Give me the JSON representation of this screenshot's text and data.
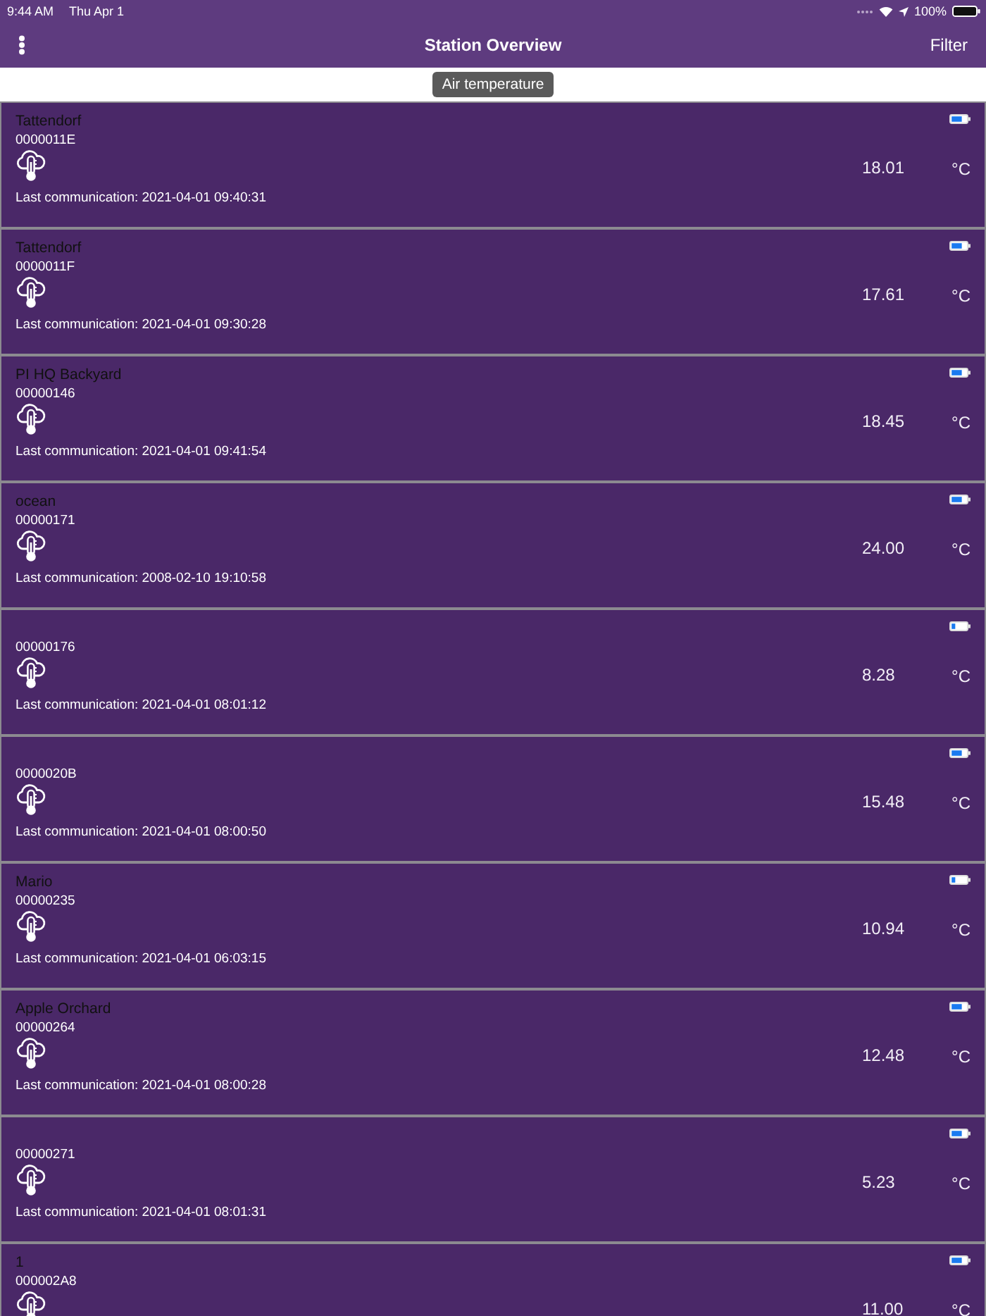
{
  "status_bar": {
    "time": "9:44 AM",
    "date": "Thu Apr 1",
    "battery_text": "100%"
  },
  "nav_bar": {
    "title": "Station Overview",
    "filter_button": "Filter"
  },
  "measurement_chip": "Air temperature",
  "stations": [
    {
      "name": "Tattendorf",
      "id": "0000011E",
      "last_communication": "Last communication: 2021-04-01 09:40:31",
      "value": "18.01",
      "unit": "°C",
      "battery_low": false
    },
    {
      "name": "Tattendorf",
      "id": "0000011F",
      "last_communication": "Last communication: 2021-04-01 09:30:28",
      "value": "17.61",
      "unit": "°C",
      "battery_low": false
    },
    {
      "name": "PI HQ Backyard",
      "id": "00000146",
      "last_communication": "Last communication: 2021-04-01 09:41:54",
      "value": "18.45",
      "unit": "°C",
      "battery_low": false
    },
    {
      "name": "ocean",
      "id": "00000171",
      "last_communication": "Last communication: 2008-02-10 19:10:58",
      "value": "24.00",
      "unit": "°C",
      "battery_low": false
    },
    {
      "id": "00000176",
      "last_communication": "Last communication: 2021-04-01 08:01:12",
      "value": "8.28",
      "unit": "°C",
      "battery_low": true
    },
    {
      "id": "0000020B",
      "last_communication": "Last communication: 2021-04-01 08:00:50",
      "value": "15.48",
      "unit": "°C",
      "battery_low": false
    },
    {
      "name": "Mario",
      "id": "00000235",
      "last_communication": "Last communication: 2021-04-01 06:03:15",
      "value": "10.94",
      "unit": "°C",
      "battery_low": true
    },
    {
      "name": "Apple Orchard",
      "id": "00000264",
      "last_communication": "Last communication: 2021-04-01 08:00:28",
      "value": "12.48",
      "unit": "°C",
      "battery_low": false
    },
    {
      "id": "00000271",
      "last_communication": "Last communication: 2021-04-01 08:01:31",
      "value": "5.23",
      "unit": "°C",
      "battery_low": false
    },
    {
      "name": "1",
      "id": "000002A8",
      "value": "11.00",
      "unit": "°C",
      "battery_low": false
    }
  ]
}
